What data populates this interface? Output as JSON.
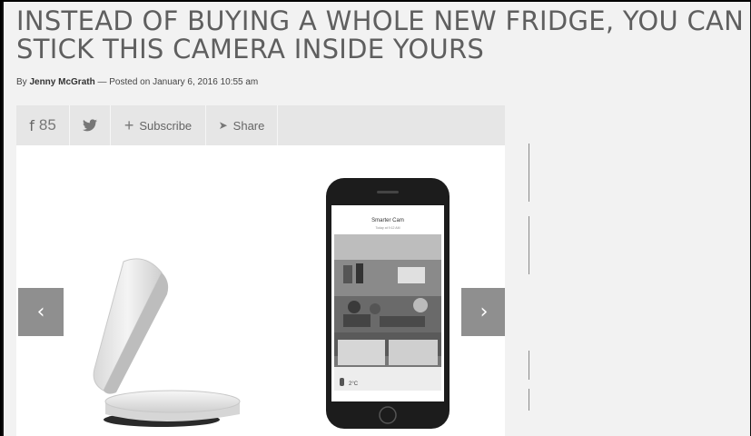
{
  "article": {
    "headline": "INSTEAD OF BUYING A WHOLE NEW FRIDGE, YOU CAN STICK THIS CAMERA INSIDE YOURS",
    "byline_prefix": "By ",
    "author": "Jenny McGrath",
    "posted": " — Posted on January 6, 2016 10:55 am"
  },
  "share_bar": {
    "facebook_icon": "f",
    "facebook_count": "85",
    "twitter_icon": "twitter-bird",
    "subscribe_label": "Subscribe",
    "share_label": "Share"
  },
  "gallery": {
    "app_title": "Smarter Cam",
    "app_subtitle": "Today at 9:12 AM",
    "temperature": "2°C",
    "prev_icon": "‹",
    "next_icon": "›"
  }
}
